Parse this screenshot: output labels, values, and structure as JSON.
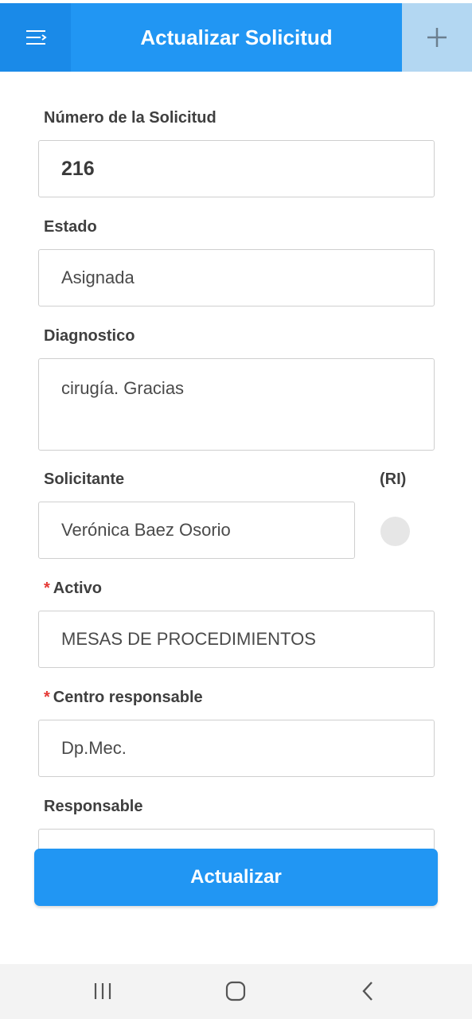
{
  "header": {
    "title": "Actualizar Solicitud",
    "menu_icon": "menu-collapse-icon",
    "add_icon": "plus-icon",
    "color": "#2196f3"
  },
  "form": {
    "numero": {
      "label": "Número de la Solicitud",
      "value": "216"
    },
    "estado": {
      "label": "Estado",
      "value": "Asignada"
    },
    "diagnostico": {
      "label": "Diagnostico",
      "value": "cirugía. Gracias"
    },
    "solicitante": {
      "label": "Solicitante",
      "value": "Verónica Baez Osorio",
      "ri_label": "(RI)"
    },
    "activo": {
      "required_mark": "*",
      "label": "Activo",
      "value": "MESAS DE PROCEDIMIENTOS"
    },
    "centro": {
      "required_mark": "*",
      "label": "Centro responsable",
      "value": "Dp.Mec."
    },
    "responsable": {
      "label": "Responsable",
      "value": ""
    }
  },
  "actions": {
    "update_label": "Actualizar"
  },
  "navbar": {
    "recents_icon": "recent-apps-icon",
    "home_icon": "home-icon",
    "back_icon": "back-icon"
  }
}
